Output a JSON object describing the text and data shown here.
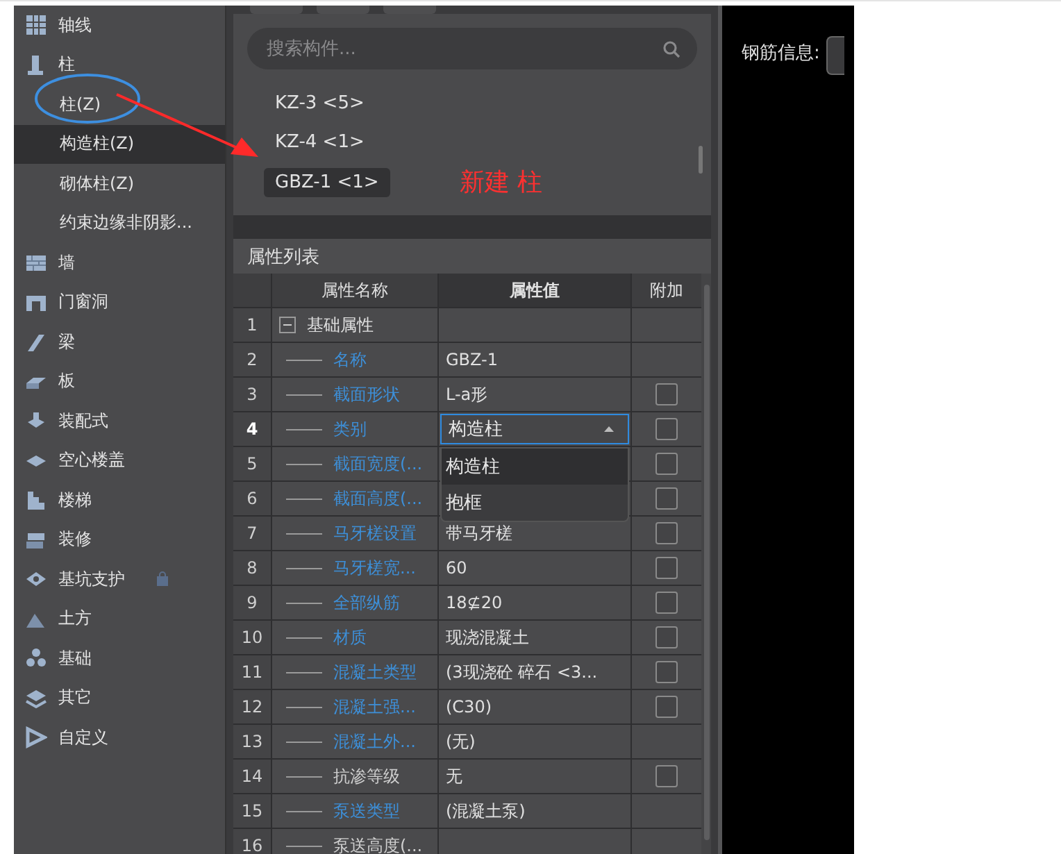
{
  "sidebar": {
    "items": [
      {
        "label": "轴线",
        "selected": false
      },
      {
        "label": "柱",
        "selected": false,
        "children": [
          {
            "label": "柱(Z)",
            "selected": false
          },
          {
            "label": "构造柱(Z)",
            "selected": true
          },
          {
            "label": "砌体柱(Z)",
            "selected": false
          },
          {
            "label": "约束边缘非阴影...",
            "selected": false
          }
        ]
      },
      {
        "label": "墙",
        "selected": false
      },
      {
        "label": "门窗洞",
        "selected": false
      },
      {
        "label": "梁",
        "selected": false
      },
      {
        "label": "板",
        "selected": false
      },
      {
        "label": "装配式",
        "selected": false
      },
      {
        "label": "空心楼盖",
        "selected": false
      },
      {
        "label": "楼梯",
        "selected": false
      },
      {
        "label": "装修",
        "selected": false
      },
      {
        "label": "基坑支护",
        "selected": false,
        "locked": true
      },
      {
        "label": "土方",
        "selected": false
      },
      {
        "label": "基础",
        "selected": false
      },
      {
        "label": "其它",
        "selected": false
      },
      {
        "label": "自定义",
        "selected": false
      }
    ]
  },
  "components": {
    "search": {
      "placeholder": "搜索构件..."
    },
    "items": [
      {
        "label": "KZ-3 <5>",
        "selected": false
      },
      {
        "label": "KZ-4 <1>",
        "selected": false
      },
      {
        "label": "GBZ-1 <1>",
        "selected": true
      }
    ],
    "annotation": "新建 柱"
  },
  "properties": {
    "title": "属性列表",
    "columns": [
      "属性名称",
      "属性值",
      "附加"
    ],
    "rows": [
      {
        "num": "1",
        "name": "基础属性",
        "kind": "group",
        "expanded": true,
        "selected": false
      },
      {
        "num": "2",
        "name": "名称",
        "value": "GBZ-1",
        "kind": "field",
        "linked": true,
        "selected": false
      },
      {
        "num": "3",
        "name": "截面形状",
        "value": "L-a形",
        "kind": "field",
        "linked": true,
        "checked": false,
        "selected": false
      },
      {
        "num": "4",
        "name": "类别",
        "value": "构造柱",
        "kind": "select",
        "linked": true,
        "checked": false,
        "selected": true,
        "options": [
          {
            "label": "构造柱",
            "selected": true
          },
          {
            "label": "抱框",
            "selected": false
          }
        ]
      },
      {
        "num": "5",
        "name": "截面宽度(...",
        "kind": "field",
        "linked": true,
        "checked": false,
        "selected": false
      },
      {
        "num": "6",
        "name": "截面高度(...",
        "kind": "field",
        "linked": true,
        "checked": false,
        "selected": false
      },
      {
        "num": "7",
        "name": "马牙槎设置",
        "value": "带马牙槎",
        "kind": "field",
        "linked": true,
        "checked": false,
        "selected": false
      },
      {
        "num": "8",
        "name": "马牙槎宽...",
        "value": "60",
        "kind": "field",
        "linked": true,
        "checked": false,
        "selected": false
      },
      {
        "num": "9",
        "name": "全部纵筋",
        "value": "18⊈20",
        "kind": "field",
        "linked": true,
        "checked": false,
        "selected": false
      },
      {
        "num": "10",
        "name": "材质",
        "value": "现浇混凝土",
        "kind": "field",
        "linked": true,
        "checked": false,
        "selected": false
      },
      {
        "num": "11",
        "name": "混凝土类型",
        "value": "(3现浇砼 碎石 <3...",
        "kind": "field",
        "linked": true,
        "checked": false,
        "selected": false
      },
      {
        "num": "12",
        "name": "混凝土强...",
        "value": "(C30)",
        "kind": "field",
        "linked": true,
        "checked": false,
        "selected": false
      },
      {
        "num": "13",
        "name": "混凝土外...",
        "value": "(无)",
        "kind": "field",
        "linked": true,
        "selected": false
      },
      {
        "num": "14",
        "name": "抗渗等级",
        "value": "无",
        "kind": "field",
        "linked": false,
        "checked": false,
        "selected": false
      },
      {
        "num": "15",
        "name": "泵送类型",
        "value": "(混凝土泵)",
        "kind": "field",
        "linked": true,
        "selected": false
      },
      {
        "num": "16",
        "name": "泵送高度(...",
        "kind": "field",
        "linked": false,
        "selected": false
      }
    ]
  },
  "rebar": {
    "label": "钢筋信息:"
  }
}
